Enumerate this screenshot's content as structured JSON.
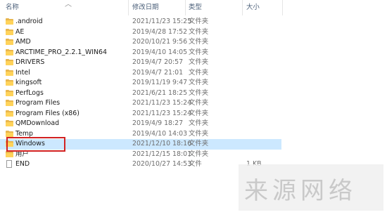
{
  "header": {
    "name": "名称",
    "date": "修改日期",
    "type": "类型",
    "size": "大小"
  },
  "rows": [
    {
      "name": ".android",
      "date": "2021/11/23 15:25",
      "type": "文件夹",
      "size": "",
      "icon": "folder-icon"
    },
    {
      "name": "AE",
      "date": "2019/4/28 17:52",
      "type": "文件夹",
      "size": "",
      "icon": "folder-icon"
    },
    {
      "name": "AMD",
      "date": "2020/10/21 9:56",
      "type": "文件夹",
      "size": "",
      "icon": "folder-icon"
    },
    {
      "name": "ARCTIME_PRO_2.2.1_WIN64",
      "date": "2019/4/10 14:05",
      "type": "文件夹",
      "size": "",
      "icon": "folder-icon"
    },
    {
      "name": "DRIVERS",
      "date": "2019/4/7 20:57",
      "type": "文件夹",
      "size": "",
      "icon": "folder-icon"
    },
    {
      "name": "Intel",
      "date": "2019/4/7 21:01",
      "type": "文件夹",
      "size": "",
      "icon": "folder-icon"
    },
    {
      "name": "kingsoft",
      "date": "2019/11/19 9:47",
      "type": "文件夹",
      "size": "",
      "icon": "folder-icon"
    },
    {
      "name": "PerfLogs",
      "date": "2021/6/21 18:25",
      "type": "文件夹",
      "size": "",
      "icon": "folder-icon"
    },
    {
      "name": "Program Files",
      "date": "2021/11/23 15:24",
      "type": "文件夹",
      "size": "",
      "icon": "folder-icon"
    },
    {
      "name": "Program Files (x86)",
      "date": "2021/11/23 15:24",
      "type": "文件夹",
      "size": "",
      "icon": "folder-icon"
    },
    {
      "name": "QMDownload",
      "date": "2019/4/9 18:27",
      "type": "文件夹",
      "size": "",
      "icon": "folder-icon"
    },
    {
      "name": "Temp",
      "date": "2019/4/10 14:03",
      "type": "文件夹",
      "size": "",
      "icon": "folder-icon"
    },
    {
      "name": "Windows",
      "date": "2021/12/10 18:16",
      "type": "文件夹",
      "size": "",
      "icon": "folder-icon",
      "selected": true
    },
    {
      "name": "用户",
      "date": "2021/12/15 18:01",
      "type": "文件夹",
      "size": "",
      "icon": "folder-icon"
    },
    {
      "name": "END",
      "date": "2020/10/27 14:53",
      "type": "文件",
      "size": "1 KB",
      "icon": "file-icon"
    }
  ],
  "watermark": {
    "text": "来源网络"
  },
  "colors": {
    "selection": "#cce8ff",
    "highlight_border": "#d22222",
    "folder": "#ffd35a"
  }
}
